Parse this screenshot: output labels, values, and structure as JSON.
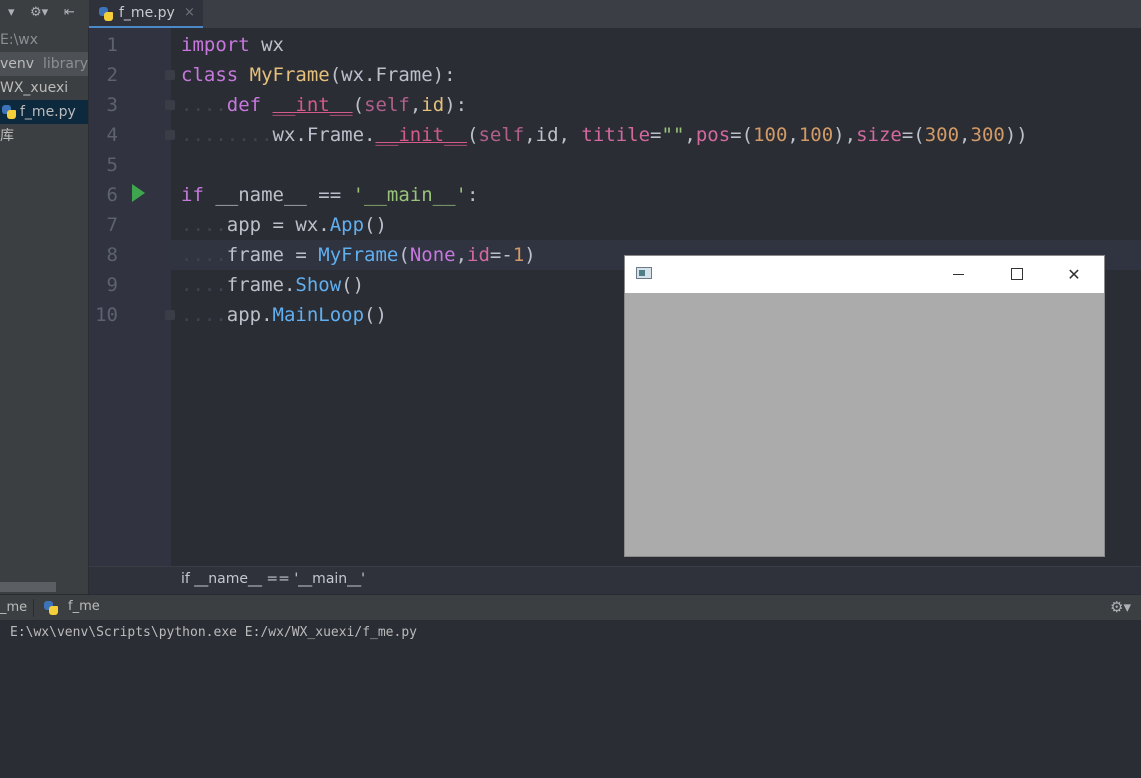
{
  "tab": {
    "label": "f_me.py",
    "close": "×"
  },
  "project_toolbar": {
    "dropdown": "▾",
    "gear": "⚙▾",
    "collapse": "⇤"
  },
  "tree": {
    "root": "E:\\wx",
    "venv_name": "venv",
    "venv_suffix": "library",
    "folder": "WX_xuexi",
    "file": "f_me.py",
    "lib": "库"
  },
  "code": {
    "line_numbers": [
      "1",
      "2",
      "3",
      "4",
      "5",
      "6",
      "7",
      "8",
      "9",
      "10"
    ]
  },
  "breadcrumb": "if __name__ == '__main__'",
  "run": {
    "prev_tab": "_me",
    "tab_label": "f_me",
    "gear": "⚙▾",
    "console_line": "E:\\wx\\venv\\Scripts\\python.exe E:/wx/WX_xuexi/f_me.py"
  },
  "wx_window": {
    "close": "✕"
  }
}
